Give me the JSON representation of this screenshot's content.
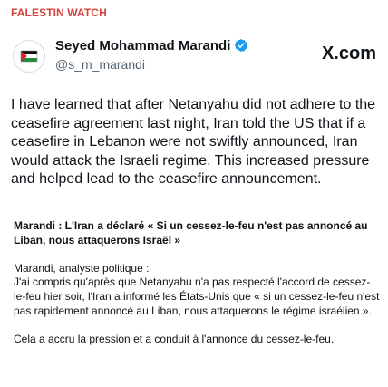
{
  "channel": {
    "name": "FALESTIN WATCH",
    "color": "#d1443b"
  },
  "tweet": {
    "author_name": "Seyed Mohammad Marandi",
    "handle": "@s_m_marandi",
    "verified_icon": "verified-badge-icon",
    "source_logo": "X.com",
    "text": "I have learned that after Netanyahu did not adhere to the ceasefire agreement last night, Iran told the US that if a ceasefire in Lebanon were not swiftly announced, Iran would attack the Israeli regime. This increased pressure and helped lead to the ceasefire announcement."
  },
  "translation": {
    "headline": "Marandi : L'Iran a déclaré « Si un cessez-le-feu n'est pas annoncé au Liban, nous attaquerons Israël »",
    "intro": "Marandi, analyste politique :",
    "quote": " J'ai compris qu'après que Netanyahu n'a pas respecté l'accord de cessez-le-feu hier soir, l'Iran a informé les États-Unis que « si un cessez-le-feu n'est pas rapidement annoncé au Liban, nous attaquerons le régime israélien ».",
    "conclusion": " Cela a accru la pression et a conduit à l'annonce du cessez-le-feu."
  }
}
